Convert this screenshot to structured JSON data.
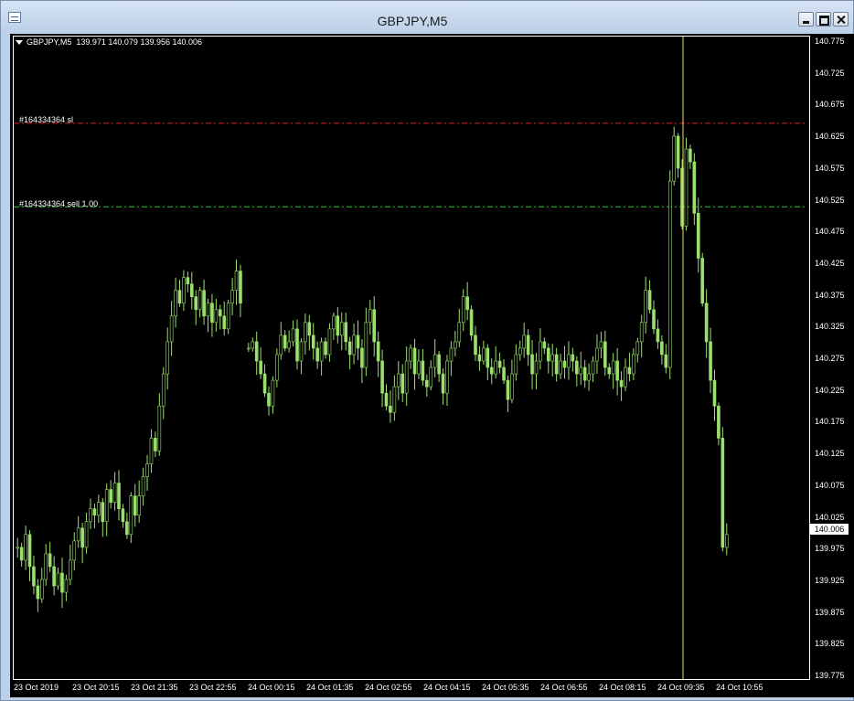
{
  "window": {
    "title": "GBPJPY,M5"
  },
  "chart_header": {
    "symbol_timeframe": "GBPJPY,M5",
    "ohlc": "139.971 140.079 139.956 140.006"
  },
  "orders": {
    "sl_label": "#164334364 sl",
    "entry_label": "#164334364 sell 1.00",
    "sl_color": "#e02020",
    "entry_color": "#32c832"
  },
  "colors": {
    "background": "#000000",
    "candle": "#9be06e",
    "vertical_marker": "#f0e06a",
    "foreground": "#ffffff"
  },
  "price_axis": {
    "ticks": [
      "140.775",
      "140.725",
      "140.675",
      "140.625",
      "140.575",
      "140.525",
      "140.475",
      "140.425",
      "140.375",
      "140.325",
      "140.275",
      "140.225",
      "140.175",
      "140.125",
      "140.075",
      "140.025",
      "139.975",
      "139.925",
      "139.875",
      "139.825",
      "139.775"
    ],
    "current_price": "140.006"
  },
  "time_axis": {
    "ticks": [
      "23 Oct 2019",
      "23 Oct 20:15",
      "23 Oct 21:35",
      "23 Oct 22:55",
      "24 Oct 00:15",
      "24 Oct 01:35",
      "24 Oct 02:55",
      "24 Oct 04:15",
      "24 Oct 05:35",
      "24 Oct 06:55",
      "24 Oct 08:15",
      "24 Oct 09:35",
      "24 Oct 10:55"
    ]
  },
  "chart_data": {
    "type": "candlestick",
    "symbol": "GBPJPY",
    "timeframe": "M5",
    "ylim": [
      139.775,
      140.775
    ],
    "sl_level": 140.64,
    "entry_level": 140.51,
    "marker_time": "24 Oct 09:55",
    "last": {
      "open": 139.971,
      "high": 140.079,
      "low": 139.956,
      "close": 140.006
    },
    "closes": [
      139.98,
      139.96,
      140.0,
      139.95,
      139.92,
      139.9,
      139.93,
      139.97,
      139.95,
      139.92,
      139.94,
      139.91,
      139.93,
      139.96,
      139.99,
      140.01,
      139.98,
      140.02,
      140.04,
      140.03,
      140.05,
      140.02,
      140.07,
      140.05,
      140.08,
      140.04,
      140.02,
      140.0,
      140.06,
      140.03,
      140.06,
      140.09,
      140.11,
      140.15,
      140.13,
      140.2,
      140.25,
      140.3,
      140.34,
      140.38,
      140.36,
      140.4,
      140.39,
      140.37,
      140.35,
      140.38,
      140.34,
      140.36,
      140.33,
      140.35,
      140.34,
      140.32,
      140.36,
      140.38,
      140.41,
      140.36,
      null,
      140.29,
      140.3,
      140.27,
      140.25,
      140.22,
      140.2,
      140.24,
      140.28,
      140.31,
      140.29,
      140.3,
      140.32,
      140.27,
      140.3,
      140.33,
      140.31,
      140.29,
      140.27,
      140.3,
      140.28,
      140.32,
      140.34,
      140.31,
      140.33,
      140.3,
      140.28,
      140.31,
      140.29,
      140.26,
      140.33,
      140.35,
      140.3,
      140.27,
      140.22,
      140.2,
      140.19,
      140.23,
      140.25,
      140.22,
      140.27,
      140.29,
      140.25,
      140.27,
      140.24,
      140.23,
      140.26,
      140.28,
      140.25,
      140.22,
      140.27,
      140.29,
      140.3,
      140.33,
      140.37,
      140.35,
      140.31,
      140.28,
      140.27,
      140.29,
      140.26,
      140.25,
      140.27,
      140.26,
      140.24,
      140.21,
      140.25,
      140.28,
      140.29,
      140.31,
      140.28,
      140.25,
      140.27,
      140.3,
      140.29,
      140.27,
      140.28,
      140.25,
      140.27,
      140.26,
      140.28,
      140.27,
      140.25,
      140.26,
      140.24,
      140.25,
      140.27,
      140.29,
      140.3,
      140.26,
      140.25,
      140.27,
      140.24,
      140.23,
      140.26,
      140.25,
      140.28,
      140.3,
      140.33,
      140.38,
      140.35,
      140.32,
      140.3,
      140.28,
      140.26,
      140.55,
      140.62,
      140.57,
      140.48,
      140.6,
      140.58,
      140.5,
      140.43,
      140.36,
      140.3,
      140.24,
      140.2,
      140.15,
      139.98,
      140.0
    ],
    "xlim": [
      "23 Oct 2019 19:00",
      "24 Oct 11:25"
    ]
  }
}
